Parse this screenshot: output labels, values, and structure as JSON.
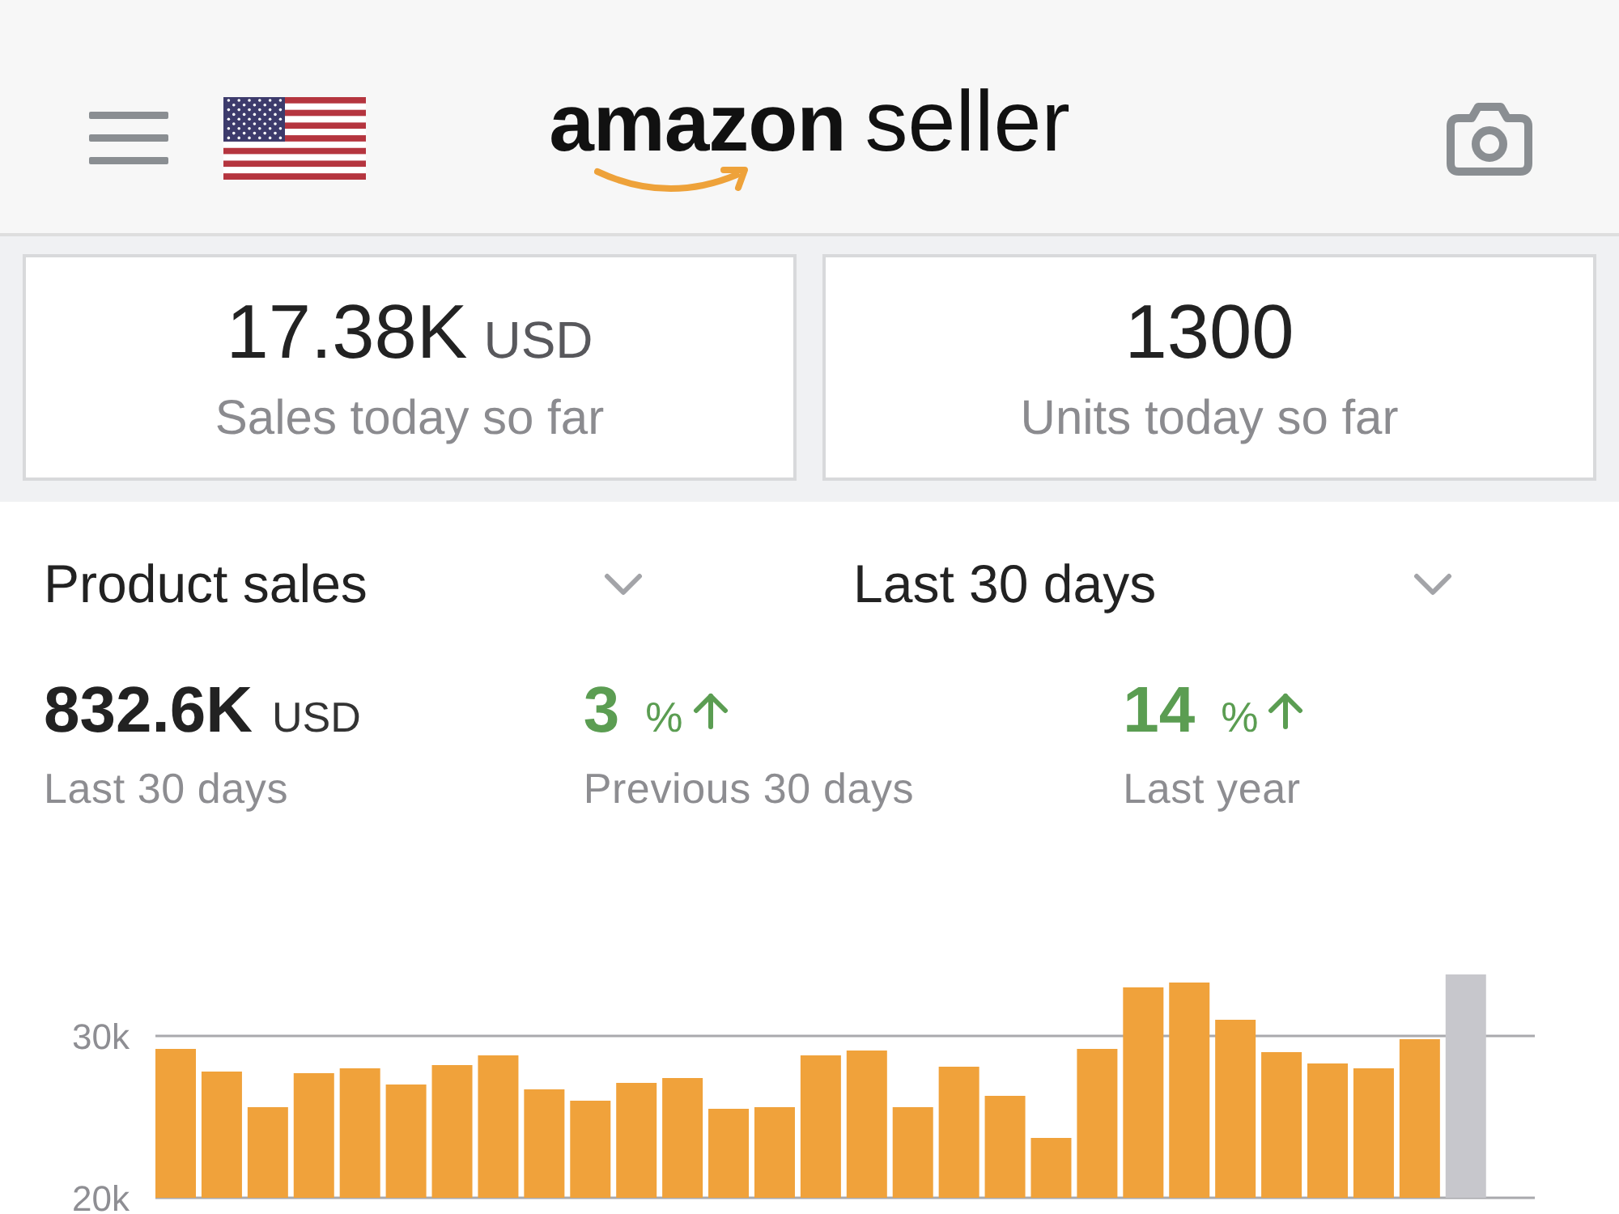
{
  "header": {
    "logo": {
      "wordmark": "amazon",
      "product": "seller"
    }
  },
  "summary_cards": [
    {
      "value": "17.38K",
      "unit": "USD",
      "label": "Sales today so far"
    },
    {
      "value": "1300",
      "label": "Units today so far"
    }
  ],
  "selectors": [
    {
      "label": "Product sales"
    },
    {
      "label": "Last 30 days"
    }
  ],
  "stats": [
    {
      "kind": "total",
      "value": "832.6K",
      "unit": "USD",
      "label": "Last 30 days"
    },
    {
      "kind": "change",
      "value": "3",
      "unit": "%",
      "increase": true,
      "label": "Previous 30 days"
    },
    {
      "kind": "change",
      "value": "14",
      "unit": "%",
      "increase": true,
      "label": "Last year"
    }
  ],
  "chart": {
    "chart_data": {
      "type": "bar",
      "stacked": true,
      "ylim": [
        20000,
        34000
      ],
      "yticks": [
        {
          "value": 20000,
          "label": "20k"
        },
        {
          "value": 30000,
          "label": "30k"
        }
      ],
      "series": [
        {
          "color": "#f0a23b",
          "values": [
            29200,
            27800,
            25600,
            27700,
            28000,
            27000,
            28200,
            28800,
            26700,
            26000,
            27100,
            27400,
            25500,
            25600,
            28800,
            29100,
            25600,
            28100,
            26300,
            23700,
            29200,
            33000,
            33300,
            31000,
            29000,
            28300,
            28000,
            29800,
            null
          ]
        },
        {
          "color": "#c7c7cc",
          "values": [
            null,
            null,
            null,
            null,
            null,
            null,
            null,
            null,
            null,
            null,
            null,
            null,
            null,
            null,
            null,
            null,
            null,
            null,
            null,
            null,
            null,
            null,
            null,
            null,
            null,
            null,
            null,
            null,
            33800
          ]
        }
      ]
    }
  }
}
